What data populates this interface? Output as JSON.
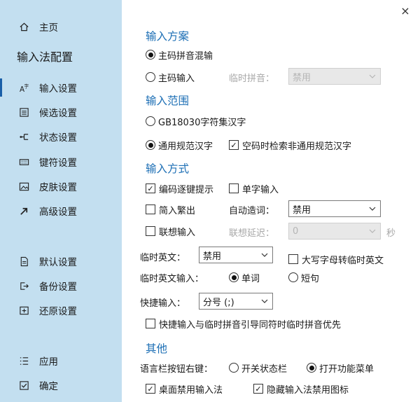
{
  "window": {
    "close_label": "×"
  },
  "sidebar": {
    "home_label": "主页",
    "section_title": "输入法配置",
    "items": [
      {
        "label": "输入设置",
        "icon": "input-settings-icon"
      },
      {
        "label": "候选设置",
        "icon": "candidate-icon"
      },
      {
        "label": "状态设置",
        "icon": "status-icon"
      },
      {
        "label": "键符设置",
        "icon": "keyboard-icon"
      },
      {
        "label": "皮肤设置",
        "icon": "image-icon"
      },
      {
        "label": "高级设置",
        "icon": "arrow-icon"
      }
    ],
    "bottom_items": [
      {
        "label": "默认设置",
        "icon": "document-icon"
      },
      {
        "label": "备份设置",
        "icon": "export-icon"
      },
      {
        "label": "还原设置",
        "icon": "import-icon"
      }
    ],
    "apply_label": "应用",
    "ok_label": "确定"
  },
  "scheme": {
    "title": "输入方案",
    "option1": "主码拼音混输",
    "option2": "主码输入",
    "temp_pinyin_label": "临时拼音：",
    "temp_pinyin_value": "禁用"
  },
  "range": {
    "title": "输入范围",
    "option1": "GB18030字符集汉字",
    "option2": "通用规范汉字",
    "check_label": "空码时检索非通用规范汉字"
  },
  "method": {
    "title": "输入方式",
    "code_hint_label": "编码逐键提示",
    "single_char_label": "单字输入",
    "simp_trad_label": "简入繁出",
    "auto_word_label": "自动造词：",
    "auto_word_value": "禁用",
    "assoc_label": "联想输入",
    "assoc_delay_label": "联想延迟：",
    "assoc_delay_value": "0",
    "assoc_delay_unit": "秒",
    "temp_en_label": "临时英文：",
    "temp_en_value": "禁用",
    "caps_label": "大写字母转临时英文",
    "temp_en_input_label": "临时英文输入：",
    "word_label": "单词",
    "sentence_label": "短句",
    "quick_label": "快捷输入：",
    "quick_value": "分号 (;)",
    "quick_priority_label": "快捷输入与临时拼音引导同符时临时拼音优先"
  },
  "other": {
    "title": "其他",
    "langbar_label": "语言栏按钮右键：",
    "toggle_status_label": "开关状态栏",
    "open_menu_label": "打开功能菜单",
    "desktop_disable_label": "桌面禁用输入法",
    "hide_icon_label": "隐藏输入法禁用图标"
  },
  "colors": {
    "sidebar_bg": "#c3dff0",
    "accent": "#1d6fb5",
    "active_bar": "#1a5fa8"
  }
}
